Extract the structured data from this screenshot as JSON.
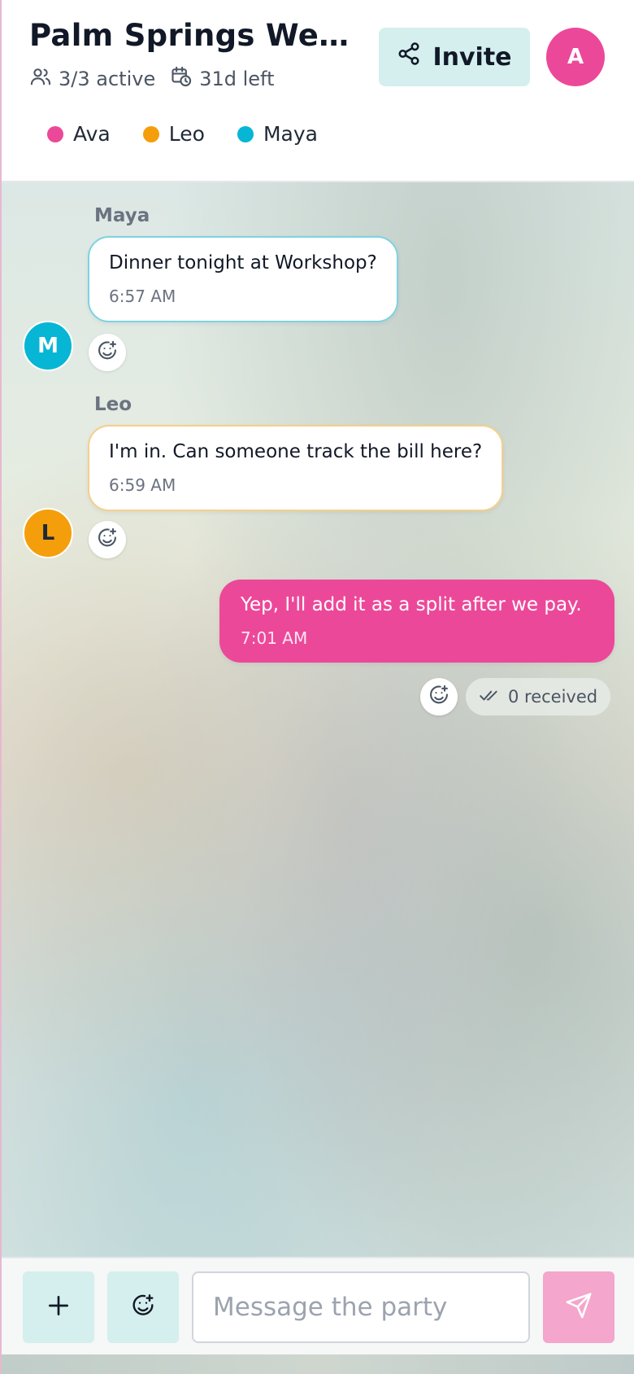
{
  "header": {
    "title": "Palm Springs Weekend",
    "active_count": "3/3 active",
    "time_left": "31d left",
    "invite_label": "Invite",
    "me_initial": "A"
  },
  "members": [
    {
      "name": "Ava",
      "color": "#ec4899"
    },
    {
      "name": "Leo",
      "color": "#f59e0b"
    },
    {
      "name": "Maya",
      "color": "#06b6d4"
    }
  ],
  "messages": [
    {
      "sender": "Maya",
      "initial": "M",
      "text": "Dinner tonight at Workshop?",
      "time": "6:57 AM",
      "color": "#06b6d4",
      "border": "#7dd3e0"
    },
    {
      "sender": "Leo",
      "initial": "L",
      "text": "I'm in. Can someone track the bill here?",
      "time": "6:59 AM",
      "color": "#f59e0b",
      "border": "#f6cf8a"
    },
    {
      "sender": "Ava",
      "text": "Yep, I'll add it as a split after we pay.",
      "time": "7:01 AM",
      "color": "#ec4899",
      "mine": true,
      "receipt": "0 received"
    }
  ],
  "composer": {
    "placeholder": "Message the party",
    "value": ""
  },
  "icons": {
    "members": "users-icon",
    "timer": "calendar-clock-icon",
    "invite": "share-icon",
    "react": "smile-plus-icon",
    "receipt": "double-check-icon",
    "attach": "plus-icon",
    "emoji": "smile-plus-icon",
    "send": "send-icon"
  }
}
